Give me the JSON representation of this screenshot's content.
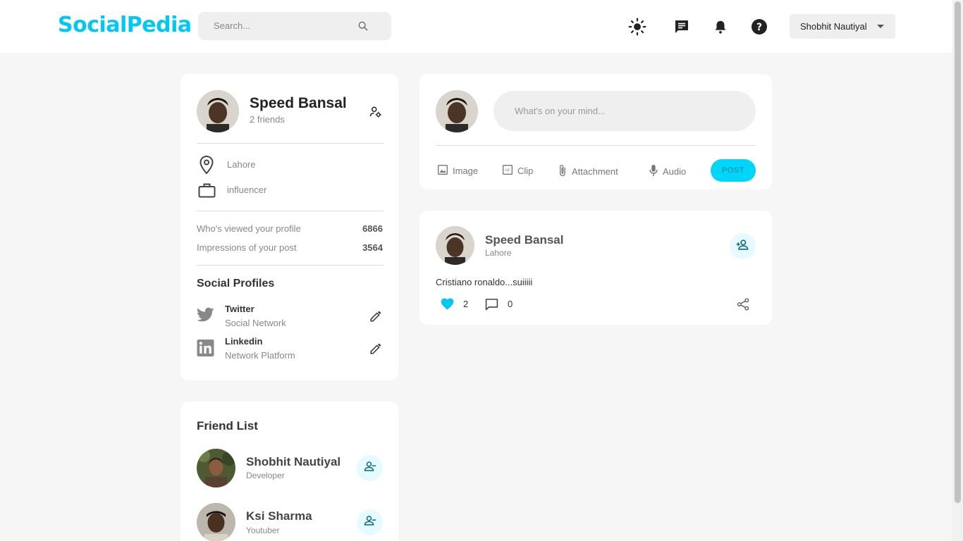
{
  "app": {
    "logo": "SocialPedia"
  },
  "navbar": {
    "search_placeholder": "Search...",
    "user_name": "Shobhit Nautiyal",
    "colors": {
      "brand": "#00c8f0",
      "accent_light": "#e6fbff"
    }
  },
  "profile": {
    "name": "Speed Bansal",
    "friends": "2 friends",
    "location": "Lahore",
    "occupation": "influencer",
    "stats": [
      {
        "label": "Who's viewed your profile",
        "value": "6866"
      },
      {
        "label": "Impressions of your post",
        "value": "3564"
      }
    ],
    "social_title": "Social Profiles",
    "social": [
      {
        "name": "Twitter",
        "sub": "Social Network",
        "icon": "twitter-icon"
      },
      {
        "name": "Linkedin",
        "sub": "Network Platform",
        "icon": "linkedin-icon"
      }
    ]
  },
  "friend_list": {
    "title": "Friend List",
    "items": [
      {
        "name": "Shobhit Nautiyal",
        "sub": "Developer"
      },
      {
        "name": "Ksi Sharma",
        "sub": "Youtuber"
      }
    ]
  },
  "compose": {
    "placeholder": "What's on your mind...",
    "actions": [
      {
        "label": "Image",
        "icon": "image-icon"
      },
      {
        "label": "Clip",
        "icon": "gif-icon"
      },
      {
        "label": "Attachment",
        "icon": "attachment-icon"
      },
      {
        "label": "Audio",
        "icon": "mic-icon"
      }
    ],
    "post_label": "POST"
  },
  "post": {
    "author": "Speed Bansal",
    "location": "Lahore",
    "text": "Cristiano ronaldo...suiiiii",
    "likes": "2",
    "comments": "0"
  }
}
